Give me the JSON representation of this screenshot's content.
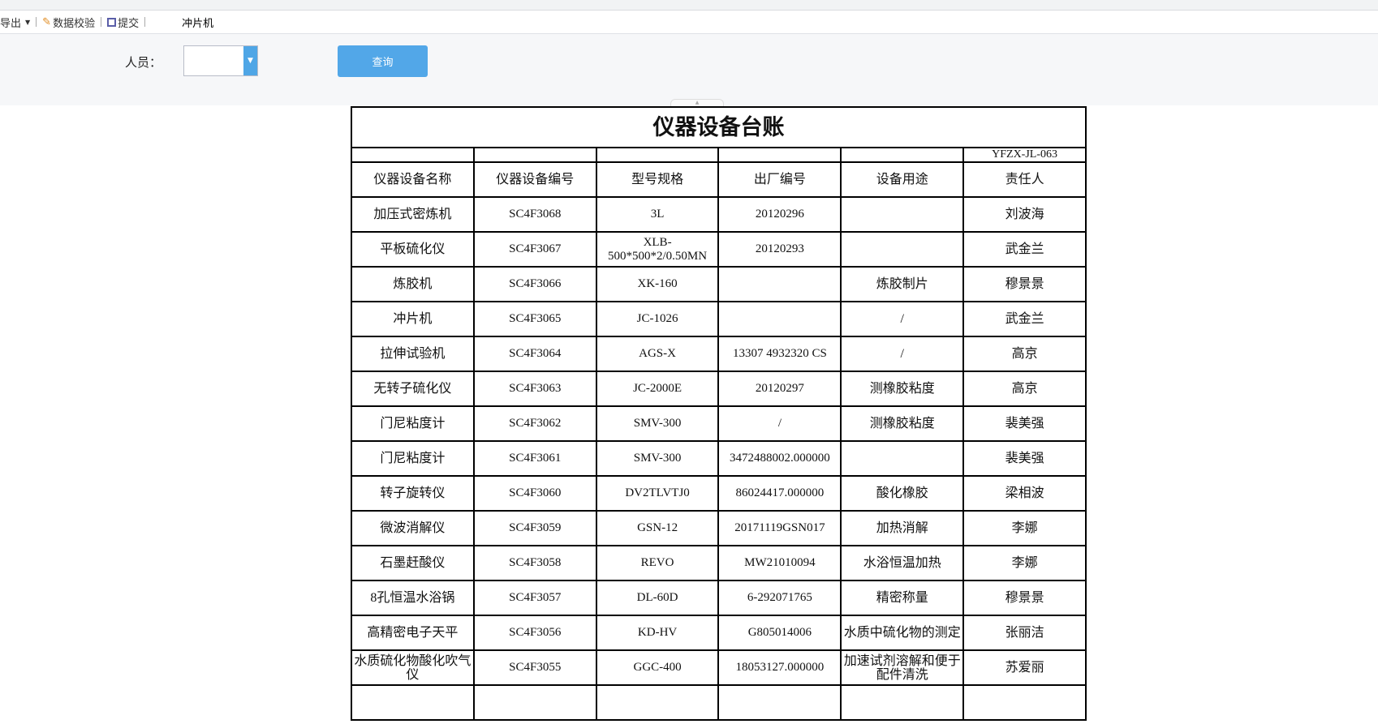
{
  "toolbar": {
    "export": "导出",
    "validate": "数据校验",
    "submit": "提交",
    "current": "冲片机"
  },
  "filter": {
    "person_label": "人员：",
    "person_value": "",
    "query_button": "查询"
  },
  "report": {
    "title": "仪器设备台账",
    "code": "YFZX-JL-063",
    "headers": [
      "仪器设备名称",
      "仪器设备编号",
      "型号规格",
      "出厂编号",
      "设备用途",
      "责任人"
    ],
    "rows": [
      [
        "加压式密炼机",
        "SC4F3068",
        "3L",
        "20120296",
        "",
        "刘波海"
      ],
      [
        "平板硫化仪",
        "SC4F3067",
        "XLB-500*500*2/0.50MN",
        "20120293",
        "",
        "武金兰"
      ],
      [
        "炼胶机",
        "SC4F3066",
        "XK-160",
        "",
        "炼胶制片",
        "穆景景"
      ],
      [
        "冲片机",
        "SC4F3065",
        "JC-1026",
        "",
        "/",
        "武金兰"
      ],
      [
        "拉伸试验机",
        "SC4F3064",
        "AGS-X",
        "13307 4932320 CS",
        "/",
        "高京"
      ],
      [
        "无转子硫化仪",
        "SC4F3063",
        "JC-2000E",
        "20120297",
        "测橡胶粘度",
        "高京"
      ],
      [
        "门尼粘度计",
        "SC4F3062",
        "SMV-300",
        "/",
        "测橡胶粘度",
        "裴美强"
      ],
      [
        "门尼粘度计",
        "SC4F3061",
        "SMV-300",
        "3472488002.000000",
        "",
        "裴美强"
      ],
      [
        "转子旋转仪",
        "SC4F3060",
        "DV2TLVTJ0",
        "86024417.000000",
        "酸化橡胶",
        "梁相波"
      ],
      [
        "微波消解仪",
        "SC4F3059",
        "GSN-12",
        "20171119GSN017",
        "加热消解",
        "李娜"
      ],
      [
        "石墨赶酸仪",
        "SC4F3058",
        "REVO",
        "MW21010094",
        "水浴恒温加热",
        "李娜"
      ],
      [
        "8孔恒温水浴锅",
        "SC4F3057",
        "DL-60D",
        "6-292071765",
        "精密称量",
        "穆景景"
      ],
      [
        "高精密电子天平",
        "SC4F3056",
        "KD-HV",
        "G805014006",
        "水质中硫化物的测定",
        "张丽洁"
      ],
      [
        "水质硫化物酸化吹气仪",
        "SC4F3055",
        "GGC-400",
        "18053127.000000",
        "加速试剂溶解和便于配件清洗",
        "苏爱丽"
      ]
    ]
  }
}
